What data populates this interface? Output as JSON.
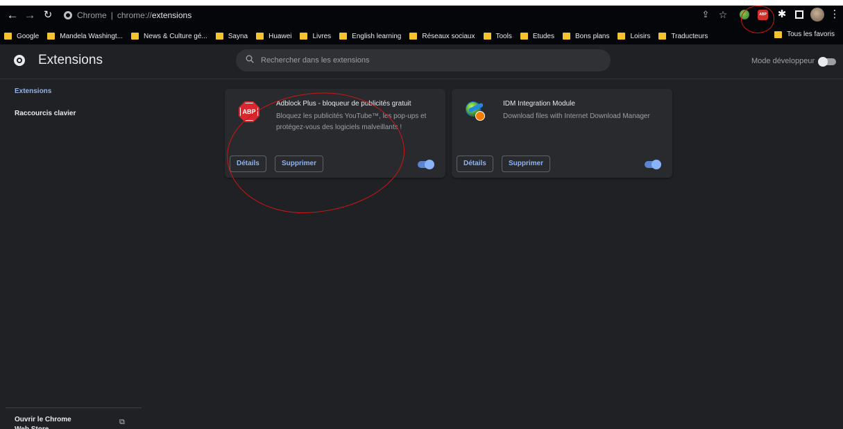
{
  "browser": {
    "omnibox_origin": "Chrome",
    "omnibox_separator": "|",
    "omnibox_scheme": "chrome://",
    "omnibox_host": "extensions"
  },
  "bookmarks": [
    {
      "label": "Google"
    },
    {
      "label": "Mandela Washingt..."
    },
    {
      "label": "News & Culture gé..."
    },
    {
      "label": "Sayna"
    },
    {
      "label": "Huawei"
    },
    {
      "label": "Livres"
    },
    {
      "label": "English learning"
    },
    {
      "label": "Réseaux sociaux"
    },
    {
      "label": "Tools"
    },
    {
      "label": "Etudes"
    },
    {
      "label": "Bons plans"
    },
    {
      "label": "Loisirs"
    },
    {
      "label": "Traducteurs"
    }
  ],
  "bookmark_all": "Tous les favoris",
  "header": {
    "title": "Extensions",
    "search_placeholder": "Rechercher dans les extensions",
    "dev_mode_label": "Mode développeur",
    "dev_mode_on": false
  },
  "sidebar": {
    "items": [
      {
        "label": "Extensions",
        "active": true
      },
      {
        "label": "Raccourcis clavier",
        "active": false
      }
    ],
    "webstore_label": "Ouvrir le Chrome Web Store"
  },
  "extensions": [
    {
      "name": "Adblock Plus - bloqueur de publicités gratuit",
      "description": "Bloquez les publicités YouTube™, les pop-ups et protégez-vous des logiciels malveillants !",
      "icon": "abp-icon",
      "icon_text": "ABP",
      "details_label": "Détails",
      "remove_label": "Supprimer",
      "enabled": true
    },
    {
      "name": "IDM Integration Module",
      "description": "Download files with Internet Download Manager",
      "icon": "idm-icon",
      "details_label": "Détails",
      "remove_label": "Supprimer",
      "enabled": true
    }
  ],
  "toolbar_icons": [
    "back-icon",
    "forward-icon",
    "reload-icon",
    "share-icon",
    "star-icon",
    "idm-icon",
    "abp-icon",
    "puzzle-icon",
    "side-panel-icon",
    "avatar",
    "menu-icon"
  ],
  "toolbar_abp_text": "ABP",
  "colors": {
    "page_bg": "#202124",
    "card_bg": "#292a2d",
    "accent": "#8ab4f8",
    "annotation": "#d01616",
    "abp_red": "#d8282f"
  }
}
